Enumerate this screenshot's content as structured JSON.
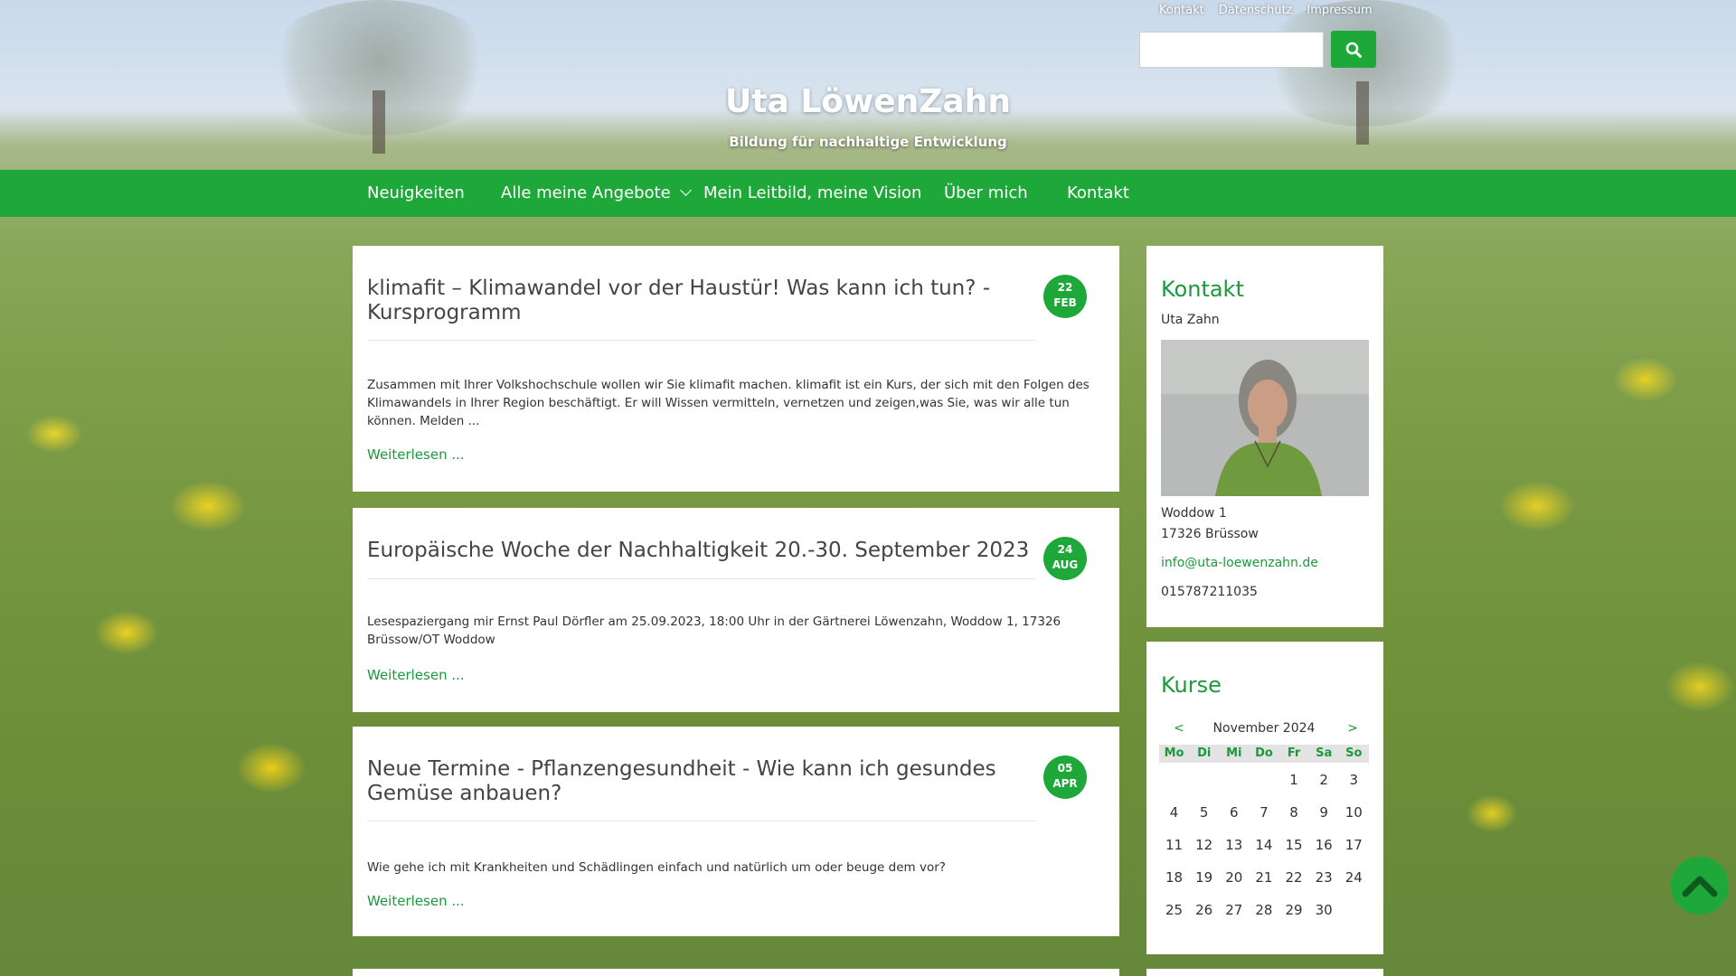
{
  "header": {
    "top_links": [
      "Kontakt",
      "Datenschutz",
      "Impressum"
    ],
    "search": {
      "value": "",
      "placeholder": ""
    },
    "site_title": "Uta LöwenZahn",
    "site_subtitle": "Bildung für nachhaltige Entwicklung"
  },
  "nav": {
    "items": [
      {
        "label": "Neuigkeiten"
      },
      {
        "label": "Alle meine Angebote"
      },
      {
        "label": "Mein Leitbild, meine Vision"
      },
      {
        "label": "Über mich"
      },
      {
        "label": "Kontakt"
      }
    ]
  },
  "posts": [
    {
      "title": "klimafit – Klimawandel vor der Haustür! Was kann ich tun? - Kursprogramm",
      "day": "22",
      "month": "FEB",
      "excerpt": "Zusammen mit Ihrer Volkshochschule wollen wir Sie klimafit machen. klimafit ist ein Kurs, der sich mit den Folgen des Klimawandels in Ihrer Region beschäftigt. Er will Wissen vermitteln, vernetzen und zeigen,was Sie, was wir alle tun können. Melden ...",
      "more": "Weiterlesen ..."
    },
    {
      "title": "Europäische Woche der Nachhaltigkeit 20.-30. September 2023",
      "day": "24",
      "month": "AUG",
      "excerpt": "Lesespaziergang mir Ernst Paul Dörfler am 25.09.2023, 18:00 Uhr in der Gärtnerei Löwenzahn, Woddow 1, 17326 Brüssow/OT Woddow",
      "more": "Weiterlesen ..."
    },
    {
      "title": "Neue Termine - Pflanzengesundheit - Wie kann ich gesundes Gemüse anbauen?",
      "day": "05",
      "month": "APR",
      "excerpt": "Wie gehe ich mit Krankheiten und Schädlingen einfach und natürlich um oder beuge dem vor?",
      "more": "Weiterlesen ..."
    }
  ],
  "sidebar": {
    "contact": {
      "title": "Kontakt",
      "name": "Uta Zahn",
      "address1": "Woddow 1",
      "address2": "17326 Brüssow",
      "email": "info@uta-loewenzahn.de",
      "phone": "015787211035"
    },
    "calendar": {
      "title": "Kurse",
      "prev": "<",
      "next": ">",
      "month": "November 2024",
      "weekdays": [
        "Mo",
        "Di",
        "Mi",
        "Do",
        "Fr",
        "Sa",
        "So"
      ],
      "weeks": [
        [
          "",
          "",
          "",
          "",
          "1",
          "2",
          "3"
        ],
        [
          "4",
          "5",
          "6",
          "7",
          "8",
          "9",
          "10"
        ],
        [
          "11",
          "12",
          "13",
          "14",
          "15",
          "16",
          "17"
        ],
        [
          "18",
          "19",
          "20",
          "21",
          "22",
          "23",
          "24"
        ],
        [
          "25",
          "26",
          "27",
          "28",
          "29",
          "30",
          ""
        ]
      ]
    }
  },
  "colors": {
    "accent": "#1fa83a",
    "link": "#1a9a3a"
  },
  "icons": {
    "search": "search-icon",
    "scroll_top": "chevron-up-icon"
  }
}
